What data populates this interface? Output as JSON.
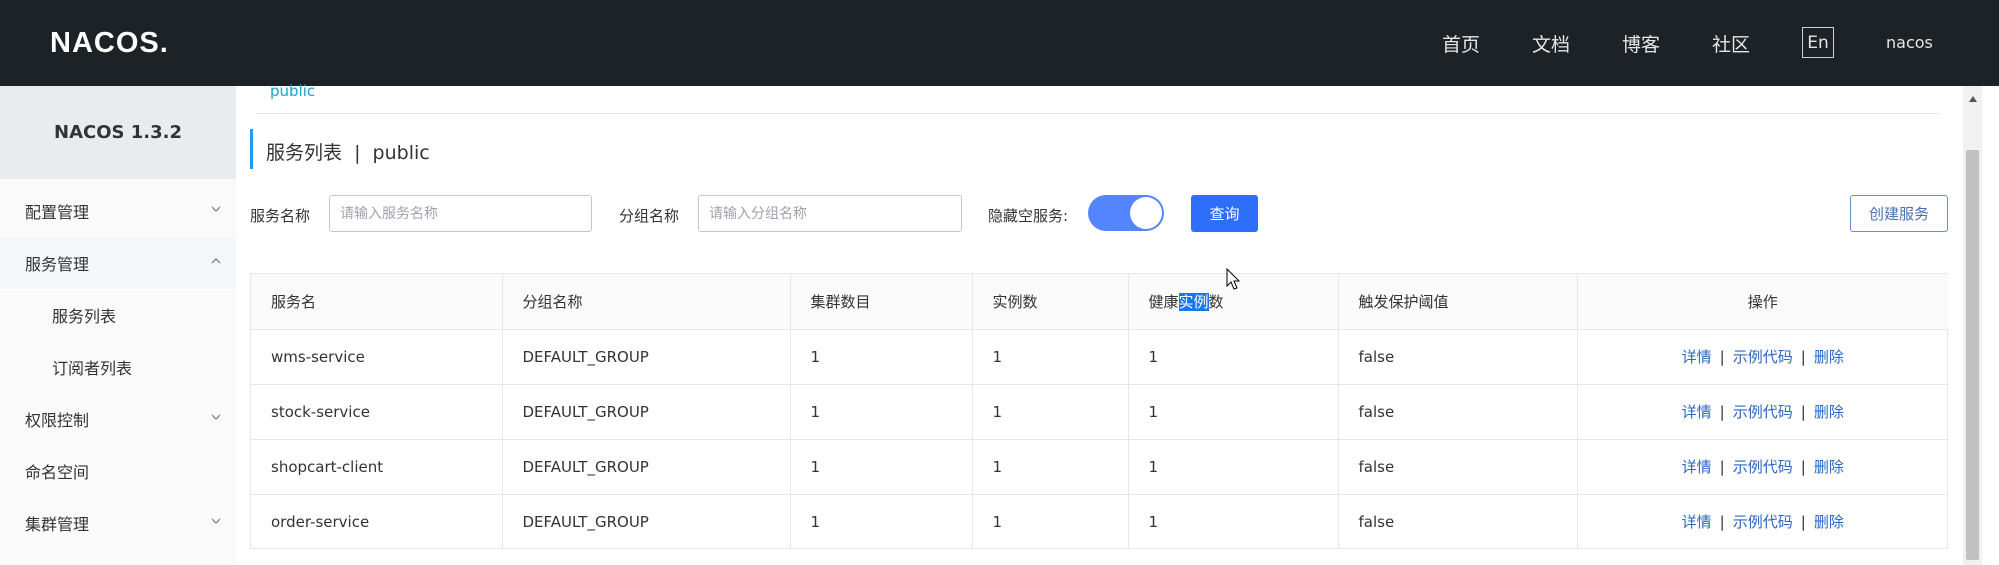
{
  "header": {
    "logo": "NACOS.",
    "nav": [
      "首页",
      "文档",
      "博客",
      "社区"
    ],
    "lang_button": "En",
    "user": "nacos"
  },
  "sidebar": {
    "version": "NACOS 1.3.2",
    "items": [
      {
        "label": "配置管理",
        "chevron": "chevron-down-icon"
      },
      {
        "label": "服务管理",
        "chevron": "chevron-up-icon"
      },
      {
        "label": "服务列表"
      },
      {
        "label": "订阅者列表"
      },
      {
        "label": "权限控制",
        "chevron": "chevron-down-icon"
      },
      {
        "label": "命名空间"
      },
      {
        "label": "集群管理",
        "chevron": "chevron-down-icon"
      }
    ]
  },
  "main": {
    "breadcrumb": "public",
    "title": "服务列表  |  public",
    "filters": {
      "service_name_label": "服务名称",
      "service_name_placeholder": "请输入服务名称",
      "group_name_label": "分组名称",
      "group_name_placeholder": "请输入分组名称",
      "hide_empty_label": "隐藏空服务:",
      "hide_empty_on": true,
      "query_button": "查询",
      "create_button": "创建服务"
    },
    "table": {
      "headers": [
        "服务名",
        "分组名称",
        "集群数目",
        "实例数",
        "健康",
        "实例",
        "数",
        "触发保护阈值",
        "操作"
      ],
      "rows": [
        [
          "wms-service",
          "DEFAULT_GROUP",
          "1",
          "1",
          "1",
          "false"
        ],
        [
          "stock-service",
          "DEFAULT_GROUP",
          "1",
          "1",
          "1",
          "false"
        ],
        [
          "shopcart-client",
          "DEFAULT_GROUP",
          "1",
          "1",
          "1",
          "false"
        ],
        [
          "order-service",
          "DEFAULT_GROUP",
          "1",
          "1",
          "1",
          "false"
        ]
      ],
      "ops": {
        "detail": "详情",
        "sample_code": "示例代码",
        "delete": "删除",
        "separator": "|"
      }
    }
  },
  "colors": {
    "topbar": "#1d2226",
    "primary": "#2d6ffa",
    "link": "#2a66c5",
    "accent": "#1aa3ca",
    "selection": "#1478f0"
  }
}
